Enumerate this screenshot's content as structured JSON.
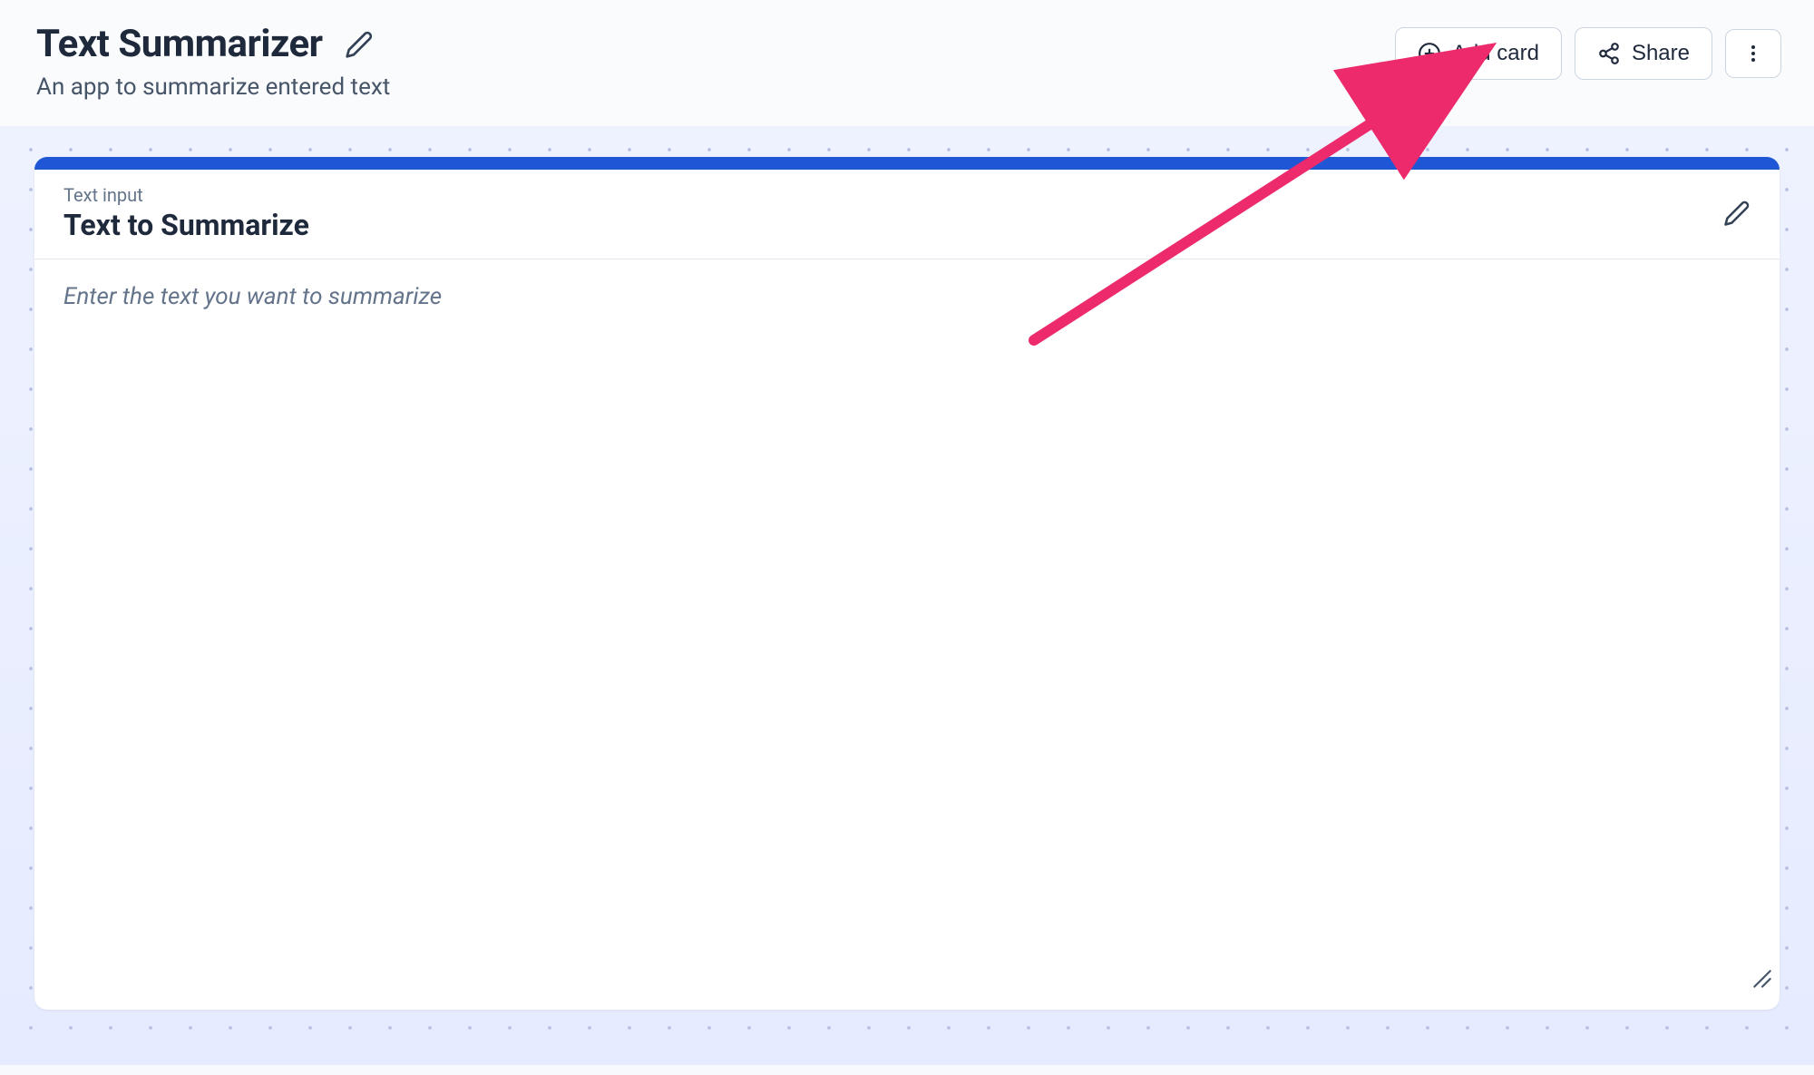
{
  "header": {
    "title": "Text Summarizer",
    "subtitle": "An app to summarize entered text",
    "add_card_label": "Add card",
    "share_label": "Share"
  },
  "card": {
    "type_label": "Text input",
    "title": "Text to Summarize",
    "placeholder": "Enter the text you want to summarize"
  },
  "colors": {
    "card_accent": "#1f56d6",
    "annotation": "#ed2b6c"
  }
}
